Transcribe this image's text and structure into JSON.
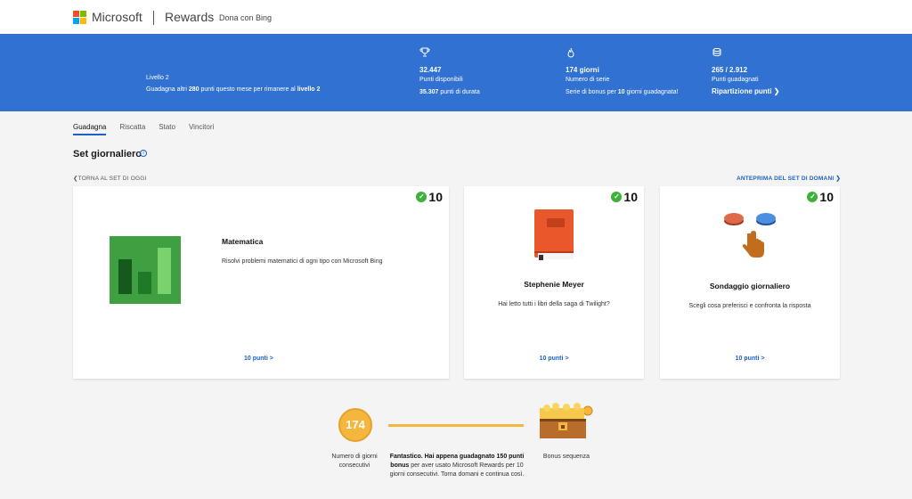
{
  "nav": {
    "brand": "Microsoft",
    "section": "Rewards",
    "donate": "Dona con Bing"
  },
  "banner": {
    "level": "Livello 2",
    "level_msg_prefix": "Guadagna altri",
    "level_msg_points": "280",
    "level_msg_mid": "punti questo mese per rimanere al",
    "level_msg_level": "livello 2",
    "available_points": "32.447",
    "available_label": "Punti disponibili",
    "lifetime_points": "35.307",
    "lifetime_label": "punti di durata",
    "streak_days": "174 giorni",
    "streak_label": "Numero di serie",
    "streak_bonus_prefix": "Serie di bonus per",
    "streak_bonus_days": "10",
    "streak_bonus_suffix": "giorni guadagnata!",
    "earned": "265 / 2.912",
    "earned_label": "Punti guadagnati",
    "breakdown_link": "Ripartizione punti ❯"
  },
  "tabs": [
    "Guadagna",
    "Riscatta",
    "Stato",
    "Vincitori"
  ],
  "daily_set": {
    "title": "Set giornaliero",
    "back_link": "❮TORNA AL SET DI OGGI",
    "next_link": "ANTEPRIMA DEL SET DI DOMANI ❯"
  },
  "cards": [
    {
      "points": "10",
      "title": "Matematica",
      "desc": "Risolvi problemi matematici di ogni tipo con Microsoft Bing",
      "link": "10 punti >",
      "icon": "bar-chart-icon"
    },
    {
      "points": "10",
      "title": "Stephenie Meyer",
      "desc": "Hai letto tutti i libri della saga di Twilight?",
      "link": "10 punti >",
      "icon": "book-icon"
    },
    {
      "points": "10",
      "title": "Sondaggio giornaliero",
      "desc": "Scegli cosa preferisci e confronta la risposta",
      "link": "10 punti >",
      "icon": "poll-buttons-icon"
    }
  ],
  "streak": {
    "count": "174",
    "count_label_1": "Numero di giorni",
    "count_label_2": "consecutivi",
    "bonus_label": "Bonus sequenza",
    "message_bold": "Fantastico. Hai appena guadagnato 150 punti bonus",
    "message_rest": "per aver usato Microsoft Rewards per 10 giorni consecutivi. Torna domani e continua così."
  },
  "colors": {
    "banner": "#3071d1",
    "link": "#1b62c6",
    "check": "#3eb13a",
    "streak": "#f4b63c",
    "math_bg": "#3ea040",
    "book": "#e8582b"
  }
}
